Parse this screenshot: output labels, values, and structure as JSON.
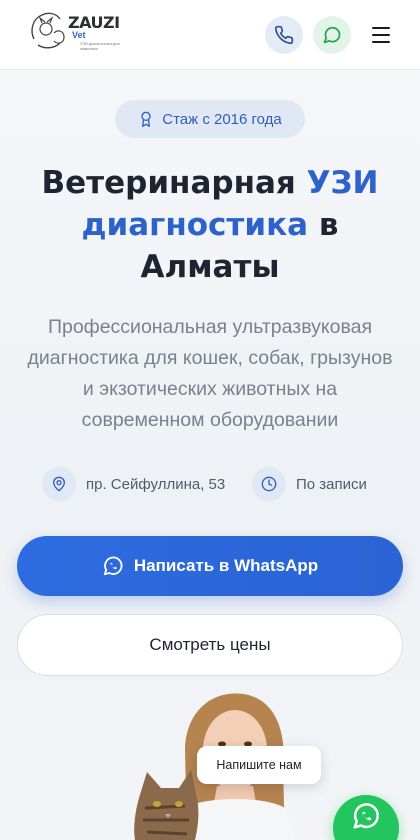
{
  "header": {
    "logo_text": "ZAUZI",
    "logo_sub": "Vet",
    "logo_tiny": "УЗИ диагностика для животных"
  },
  "badge": {
    "label": "Стаж с 2016 года"
  },
  "hero": {
    "title_part1": "Ветеринарная ",
    "title_accent": "УЗИ диагностика",
    "title_part2": " в Алматы",
    "subtitle": "Профессиональная ультразвуковая диагностика для кошек, собак, грызунов и экзотических животных на современном оборудовании"
  },
  "info": {
    "address": "пр. Сейфуллина, 53",
    "schedule": "По записи"
  },
  "cta": {
    "whatsapp_label": "Написать в WhatsApp",
    "prices_label": "Смотреть цены"
  },
  "chat": {
    "bubble_text": "Напишите нам"
  },
  "colors": {
    "accent": "#2c62c9",
    "whatsapp_green": "#22c55e",
    "badge_bg": "#e1e8f5",
    "muted_text": "#7b818c"
  }
}
